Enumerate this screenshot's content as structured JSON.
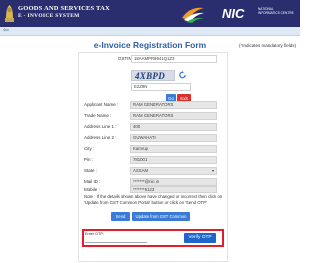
{
  "header": {
    "title_line1": "GOODS AND SERVICES TAX",
    "title_line2": "E - INVOICE SYSTEM",
    "nic_text": "NIC",
    "nic_sub": "NATIONAL INFORMATICS CENTRE"
  },
  "nav": {
    "back_icon": "⇦"
  },
  "page": {
    "title": "e-Invoice Registration Form",
    "mandatory_star": "*",
    "mandatory_text": "Indicates mandatory fields"
  },
  "form": {
    "gstin": {
      "label": "GSTIN*",
      "value": "18AAMPR9941Q1Z3"
    },
    "captcha": {
      "image_text": "4XBPD",
      "value": "E2Z9N"
    },
    "go_label": "Go",
    "exit_label": "Exit",
    "fields": [
      {
        "label": "Applicant Name :",
        "value": "RAM GENERATORS"
      },
      {
        "label": "Trade Name :",
        "value": "RAM GENERATORS"
      },
      {
        "label": "Address Line 1 :",
        "value": "400"
      },
      {
        "label": "Address Line 2 :",
        "value": "GUWAHATI"
      },
      {
        "label": "City :",
        "value": "Kamrup"
      },
      {
        "label": "Pin :",
        "value": "781001"
      },
      {
        "label": "State :",
        "value": "ASSAM"
      },
      {
        "label": "Mail ID :",
        "value": "*******@nic.in"
      },
      {
        "label": "Mobile :",
        "value": "*******5123"
      }
    ],
    "note": "Note : If the details shown above have changed or incorrect then click on 'Update from GST Common Portal' button or click on 'Send OTP'",
    "send_otp_label": "Send OTP",
    "update_label": "Update from GST Common Portal",
    "otp": {
      "label": "Enter OTP:",
      "placeholder": ""
    },
    "verify_label": "Verify OTP"
  },
  "colors": {
    "header_bg": "#2a2e6e",
    "title_blue": "#2e5fa8",
    "button_blue": "#3a7bd5",
    "exit_red": "#d9302c",
    "highlight_red": "#e51d2a"
  }
}
